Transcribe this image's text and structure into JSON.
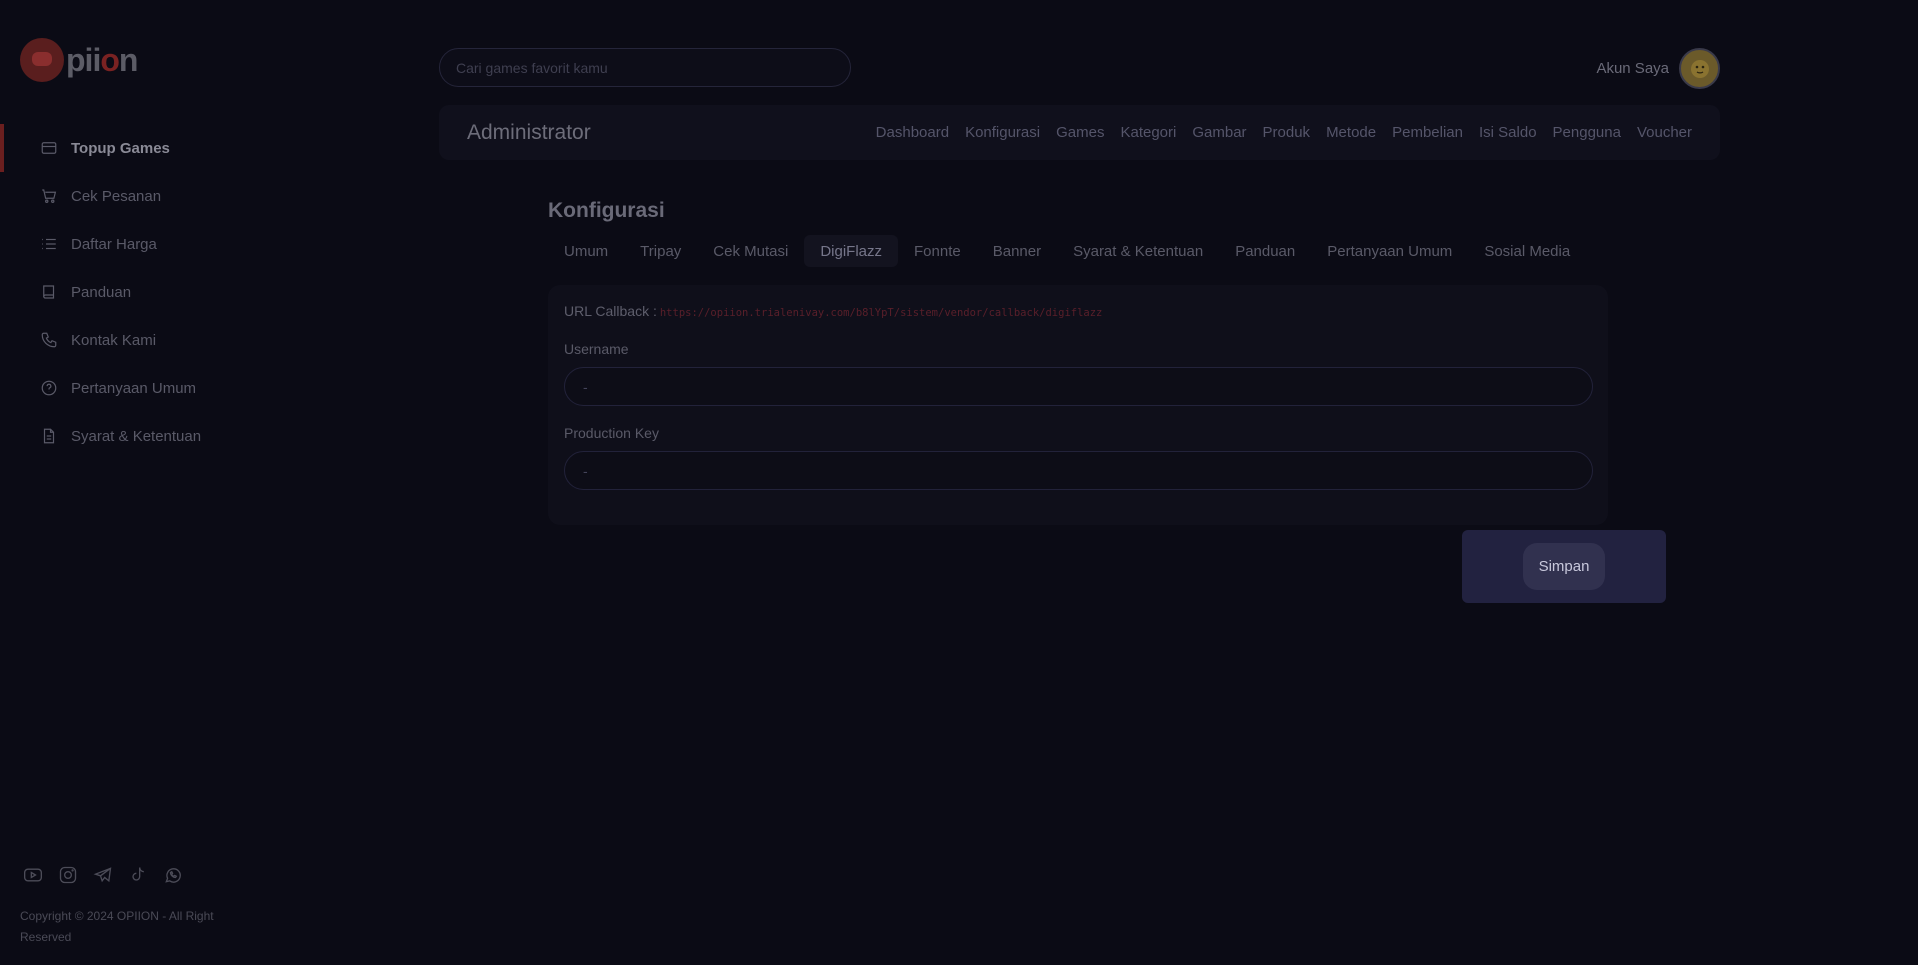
{
  "brand": {
    "name_prefix": "pii",
    "name_o": "o",
    "name_suffix": "n"
  },
  "sidebar": {
    "items": [
      {
        "label": "Topup Games",
        "icon": "credit-card-icon",
        "active": true
      },
      {
        "label": "Cek Pesanan",
        "icon": "cart-icon"
      },
      {
        "label": "Daftar Harga",
        "icon": "list-icon"
      },
      {
        "label": "Panduan",
        "icon": "book-icon"
      },
      {
        "label": "Kontak Kami",
        "icon": "phone-icon"
      },
      {
        "label": "Pertanyaan Umum",
        "icon": "question-icon"
      },
      {
        "label": "Syarat & Ketentuan",
        "icon": "document-icon"
      }
    ],
    "social": [
      "youtube-icon",
      "instagram-icon",
      "telegram-icon",
      "tiktok-icon",
      "whatsapp-icon"
    ],
    "copyright": "Copyright © 2024 OPIION - All Right Reserved"
  },
  "header": {
    "search_placeholder": "Cari games favorit kamu",
    "account_label": "Akun Saya"
  },
  "admin": {
    "title": "Administrator",
    "menu": [
      "Dashboard",
      "Konfigurasi",
      "Games",
      "Kategori",
      "Gambar",
      "Produk",
      "Metode",
      "Pembelian",
      "Isi Saldo",
      "Pengguna",
      "Voucher"
    ]
  },
  "main": {
    "title": "Konfigurasi",
    "tabs": [
      {
        "label": "Umum"
      },
      {
        "label": "Tripay"
      },
      {
        "label": "Cek Mutasi"
      },
      {
        "label": "DigiFlazz",
        "active": true
      },
      {
        "label": "Fonnte"
      },
      {
        "label": "Banner"
      },
      {
        "label": "Syarat & Ketentuan"
      },
      {
        "label": "Panduan"
      },
      {
        "label": "Pertanyaan Umum"
      },
      {
        "label": "Sosial Media"
      }
    ],
    "callback_label": "URL Callback :",
    "callback_url": "https://opiion.trialenivay.com/b8lYpT/sistem/vendor/callback/digiflazz",
    "username_label": "Username",
    "username_value": "-",
    "production_key_label": "Production Key",
    "production_key_value": "-",
    "save_label": "Simpan"
  },
  "colors": {
    "background": "#0b0b15",
    "accent": "#6b1f1f",
    "save_panel": "#222240"
  }
}
